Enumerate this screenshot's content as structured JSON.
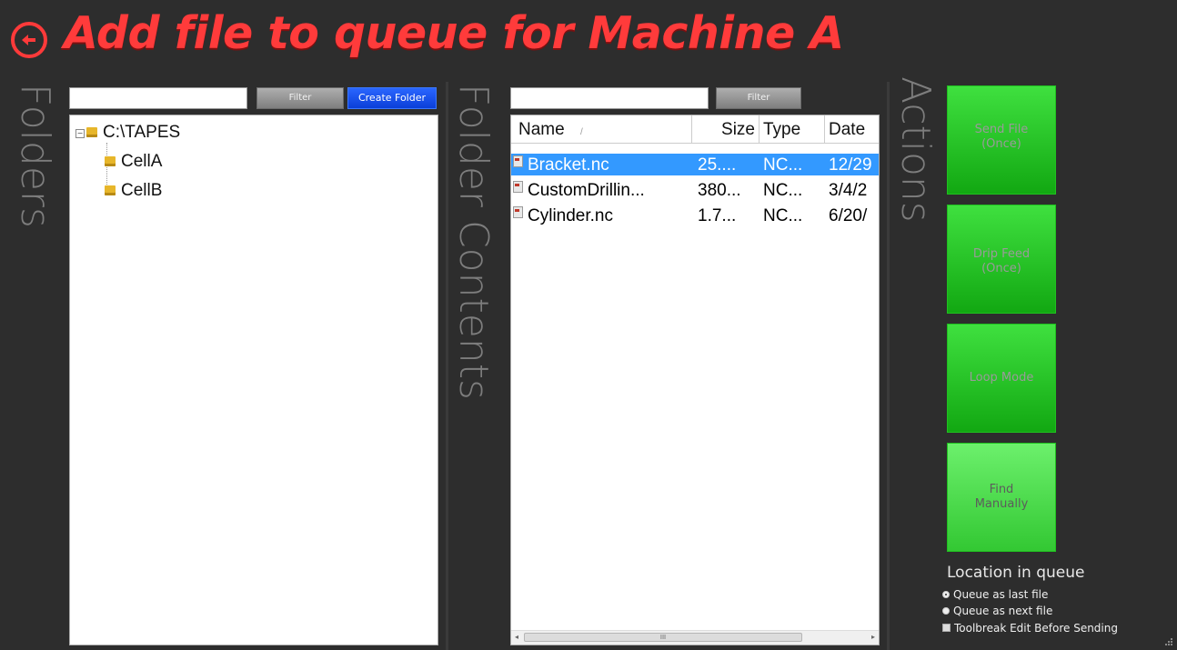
{
  "header": {
    "title": "Add file to queue for Machine A",
    "back_icon": "back-arrow-icon",
    "title_color": "#ff3b3b"
  },
  "sections": {
    "folders": "Folders",
    "folder_contents": "Folder Contents",
    "actions": "Actions"
  },
  "folders_toolbar": {
    "filter_value": "",
    "filter_label": "Filter",
    "create_folder_label": "Create Folder"
  },
  "folder_tree": {
    "root": "C:\\TAPES",
    "children": [
      "CellA",
      "CellB"
    ],
    "selected": "CellA"
  },
  "contents_toolbar": {
    "filter_value": "",
    "filter_label": "Filter"
  },
  "file_list": {
    "columns": [
      "Name",
      "Size",
      "Type",
      "Date"
    ],
    "rows": [
      {
        "name": "Bracket.nc",
        "size": "25....",
        "type": "NC...",
        "date": "12/29",
        "selected": true
      },
      {
        "name": "CustomDrillin...",
        "size": "380...",
        "type": "NC...",
        "date": "3/4/2",
        "selected": false
      },
      {
        "name": "Cylinder.nc",
        "size": "1.7...",
        "type": "NC...",
        "date": "6/20/",
        "selected": false
      }
    ],
    "scroll_thumb": "III"
  },
  "actions": {
    "send_file": "Send File\n(Once)",
    "drip_feed": "Drip Feed\n(Once)",
    "loop_mode": "Loop Mode",
    "find_manually": "Find\nManually",
    "button_color": "#22c322"
  },
  "location": {
    "title": "Location in queue",
    "queue_last": "Queue as last file",
    "queue_next": "Queue as next file",
    "selected": "Queue as last file",
    "toolbreak": "Toolbreak Edit Before Sending",
    "toolbreak_checked": false
  }
}
